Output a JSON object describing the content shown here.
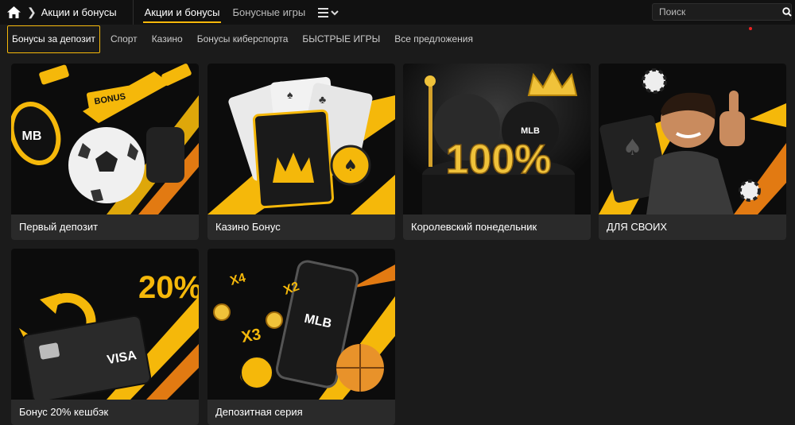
{
  "header": {
    "breadcrumb": "Акции и бонусы",
    "tabs": [
      {
        "label": "Акции и бонусы",
        "active": true
      },
      {
        "label": "Бонусные игры",
        "active": false
      }
    ],
    "search_placeholder": "Поиск",
    "home_icon": "home-icon",
    "menu_icon": "hamburger-chevron-icon"
  },
  "subnav": {
    "tabs": [
      {
        "label": "Бонусы за депозит",
        "active": true
      },
      {
        "label": "Спорт"
      },
      {
        "label": "Казино"
      },
      {
        "label": "Бонусы киберспорта"
      },
      {
        "label": "БЫСТРЫЕ ИГРЫ"
      },
      {
        "label": "Все предложения"
      }
    ]
  },
  "cards": [
    {
      "title": "Первый депозит",
      "art": {
        "badge": "BONUS",
        "logo": "MB"
      }
    },
    {
      "title": "Казино Бонус"
    },
    {
      "title": "Королевский понедельник",
      "art": {
        "headline": "100%",
        "logo": "MLB"
      }
    },
    {
      "title": "ДЛЯ СВОИХ"
    },
    {
      "title": "Бонус 20% кешбэк",
      "art": {
        "headline": "20%",
        "brand": "VISA"
      }
    },
    {
      "title": "Депозитная серия",
      "art": {
        "logo": "MLB",
        "multipliers": [
          "X4",
          "X2",
          "X3"
        ]
      }
    }
  ],
  "colors": {
    "accent": "#f5b80a",
    "background": "#1b1b1b",
    "card": "#2a2a2a"
  }
}
